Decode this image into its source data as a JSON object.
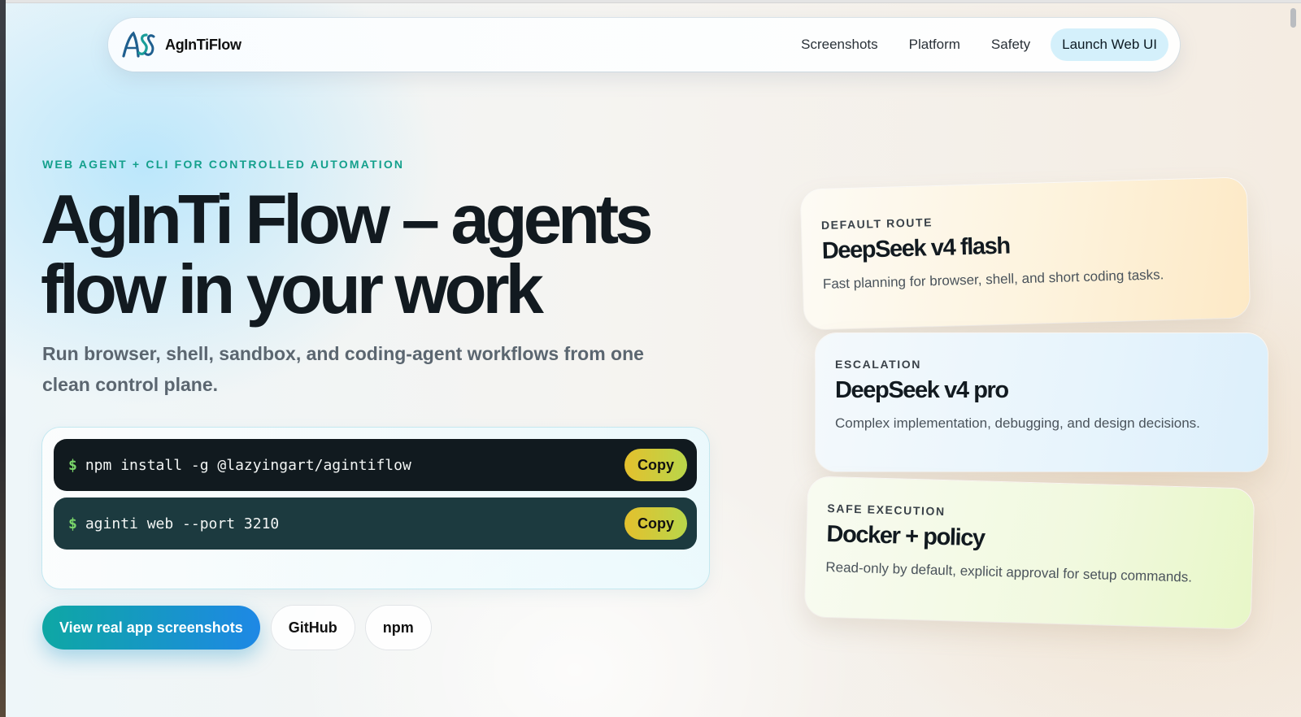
{
  "nav": {
    "brand": "AgInTiFlow",
    "links": [
      "Screenshots",
      "Platform",
      "Safety"
    ],
    "cta": "Launch Web UI"
  },
  "hero": {
    "eyebrow": "WEB AGENT + CLI FOR CONTROLLED AUTOMATION",
    "headline_line1": "AgInTi Flow – agents",
    "headline_line2": "flow in your work",
    "subhead": "Run browser, shell, sandbox, and coding-agent workflows from one clean control plane."
  },
  "commands": [
    {
      "prompt": "$",
      "text": "npm install -g @lazyingart/agintiflow",
      "copy": "Copy"
    },
    {
      "prompt": "$",
      "text": "aginti web --port 3210",
      "copy": "Copy"
    }
  ],
  "ctas": {
    "primary": "View real app screenshots",
    "github": "GitHub",
    "npm": "npm"
  },
  "cards": [
    {
      "label": "DEFAULT ROUTE",
      "title": "DeepSeek v4 flash",
      "desc": "Fast planning for browser, shell, and short coding tasks."
    },
    {
      "label": "ESCALATION",
      "title": "DeepSeek v4 pro",
      "desc": "Complex implementation, debugging, and design decisions."
    },
    {
      "label": "SAFE EXECUTION",
      "title": "Docker + policy",
      "desc": "Read-only by default, explicit approval for setup commands."
    }
  ],
  "colors": {
    "accent": "#14a08c",
    "primary_gradient_start": "#0ea7a4",
    "primary_gradient_end": "#1e88e5",
    "copy_button": "#e4c02d"
  }
}
